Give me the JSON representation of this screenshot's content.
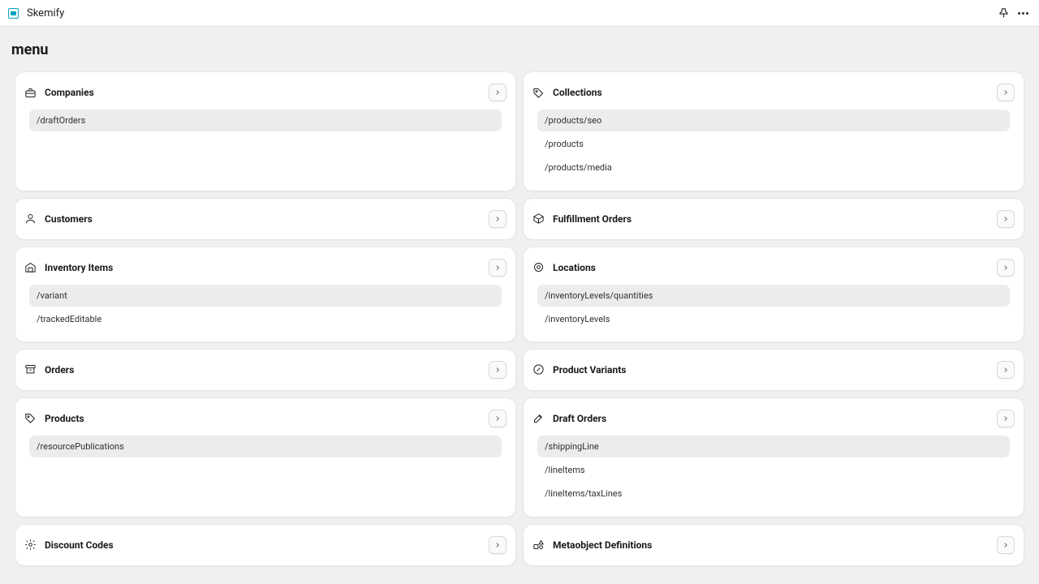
{
  "app": {
    "title": "Skemify"
  },
  "page": {
    "title": "menu"
  },
  "cards": [
    {
      "id": "companies",
      "icon": "briefcase",
      "title": "Companies",
      "items": [
        "/draftOrders"
      ],
      "selected": 0,
      "minHeight": 138
    },
    {
      "id": "collections",
      "icon": "tag",
      "title": "Collections",
      "items": [
        "/products/seo",
        "/products",
        "/products/media"
      ],
      "selected": 0,
      "minHeight": 138
    },
    {
      "id": "customers",
      "icon": "person",
      "title": "Customers",
      "items": [],
      "selected": -1,
      "minHeight": 46
    },
    {
      "id": "fulfillment-orders",
      "icon": "box",
      "title": "Fulfillment Orders",
      "items": [],
      "selected": -1,
      "minHeight": 46
    },
    {
      "id": "inventory-items",
      "icon": "warehouse",
      "title": "Inventory Items",
      "items": [
        "/variant",
        "/trackedEditable"
      ],
      "selected": 0,
      "minHeight": 100
    },
    {
      "id": "locations",
      "icon": "pin",
      "title": "Locations",
      "items": [
        "/inventoryLevels/quantities",
        "/inventoryLevels"
      ],
      "selected": 0,
      "minHeight": 100
    },
    {
      "id": "orders",
      "icon": "archive",
      "title": "Orders",
      "items": [],
      "selected": -1,
      "minHeight": 46
    },
    {
      "id": "product-variants",
      "icon": "link",
      "title": "Product Variants",
      "items": [],
      "selected": -1,
      "minHeight": 46
    },
    {
      "id": "products",
      "icon": "tag",
      "title": "Products",
      "items": [
        "/resourcePublications"
      ],
      "selected": 0,
      "minHeight": 138
    },
    {
      "id": "draft-orders",
      "icon": "edit",
      "title": "Draft Orders",
      "items": [
        "/shippingLine",
        "/lineItems",
        "/lineItems/taxLines"
      ],
      "selected": 0,
      "minHeight": 138
    },
    {
      "id": "discount-codes",
      "icon": "gear",
      "title": "Discount Codes",
      "items": [],
      "selected": -1,
      "minHeight": 46
    },
    {
      "id": "metaobject-definitions",
      "icon": "shapes",
      "title": "Metaobject Definitions",
      "items": [],
      "selected": -1,
      "minHeight": 46
    }
  ]
}
